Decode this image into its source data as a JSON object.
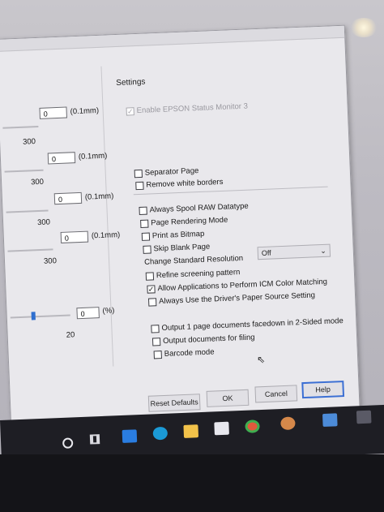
{
  "settings": {
    "title": "Settings",
    "enable_status_monitor": {
      "label": "Enable EPSON Status Monitor 3",
      "checked": true,
      "disabled": true
    },
    "separator_page": {
      "label": "Separator Page",
      "checked": false
    },
    "remove_white_borders": {
      "label": "Remove white borders",
      "checked": false
    },
    "always_spool_raw": {
      "label": "Always Spool RAW Datatype",
      "checked": false
    },
    "page_rendering_mode": {
      "label": "Page Rendering Mode",
      "checked": false
    },
    "print_as_bitmap": {
      "label": "Print as Bitmap",
      "checked": false
    },
    "skip_blank_page": {
      "label": "Skip Blank Page",
      "checked": false
    },
    "change_resolution_label": "Change Standard Resolution",
    "change_resolution_value": "Off",
    "refine_screening": {
      "label": "Refine screening pattern",
      "checked": false
    },
    "allow_icm": {
      "label": "Allow Applications to Perform ICM Color Matching",
      "checked": true
    },
    "always_use_driver_source": {
      "label": "Always Use the Driver's Paper Source Setting",
      "checked": false
    },
    "output_1page_facedown": {
      "label": "Output 1 page documents facedown in 2-Sided mode",
      "checked": false
    },
    "output_for_filing": {
      "label": "Output documents for filing",
      "checked": false
    },
    "barcode_mode": {
      "label": "Barcode mode",
      "checked": false
    }
  },
  "left": {
    "rows": [
      {
        "value": "0",
        "unit": "(0.1mm)",
        "max": "300"
      },
      {
        "value": "0",
        "unit": "(0.1mm)",
        "max": "300"
      },
      {
        "value": "0",
        "unit": "(0.1mm)",
        "max": "300"
      },
      {
        "value": "0",
        "unit": "(0.1mm)",
        "max": "300"
      }
    ],
    "percent": {
      "value": "0",
      "unit": "(%)",
      "max": "20"
    }
  },
  "buttons": {
    "reset_defaults": "Reset Defaults",
    "ok": "OK",
    "cancel": "Cancel",
    "help": "Help"
  },
  "taskbar": {
    "icons": [
      "search-circle-icon",
      "task-view-icon",
      "mail-icon",
      "edge-icon",
      "file-explorer-icon",
      "store-icon",
      "chrome-icon",
      "app-icon",
      "photos-icon",
      "notification-icon"
    ]
  },
  "colors": {
    "accent": "#3b6fd4",
    "dialog_bg": "#e9e8ec",
    "taskbar_bg": "#1e1e24"
  }
}
